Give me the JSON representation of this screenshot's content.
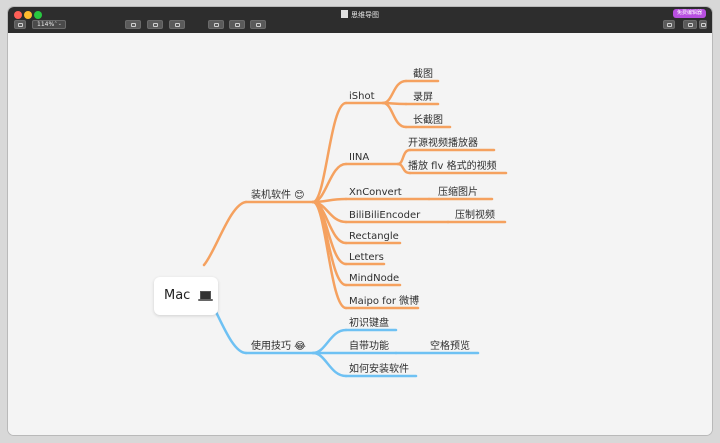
{
  "window": {
    "title": "思维导图",
    "badge": "免费编辑器"
  },
  "toolbar": {
    "zoom": "114%",
    "zoom_chevron": "⌃⌄"
  },
  "mindmap": {
    "root": "Mac",
    "branch_software": "装机软件 😊",
    "branch_tips": "使用技巧 😂",
    "software": {
      "ishot": "iShot",
      "ishot_children": [
        "截图",
        "录屏",
        "长截图"
      ],
      "iina": "IINA",
      "iina_children": [
        "开源视频播放器",
        "播放  flv  格式的视频"
      ],
      "xnconvert": "XnConvert",
      "xnconvert_child": "压缩图片",
      "bilibili": "BiliBiliEncoder",
      "bilibili_child": "压制视频",
      "rectangle": "Rectangle",
      "letters": "Letters",
      "mindnode": "MindNode",
      "maipo": "Maipo for 微博"
    },
    "tips": {
      "keyboard": "初识键盘",
      "builtin": "自带功能",
      "builtin_child": "空格预览",
      "install": "如何安装软件"
    }
  },
  "colors": {
    "orange": "#f5a15f",
    "blue": "#6ec1f3",
    "toolbar": "#2d2d2d",
    "canvas": "#f4f4f4"
  }
}
